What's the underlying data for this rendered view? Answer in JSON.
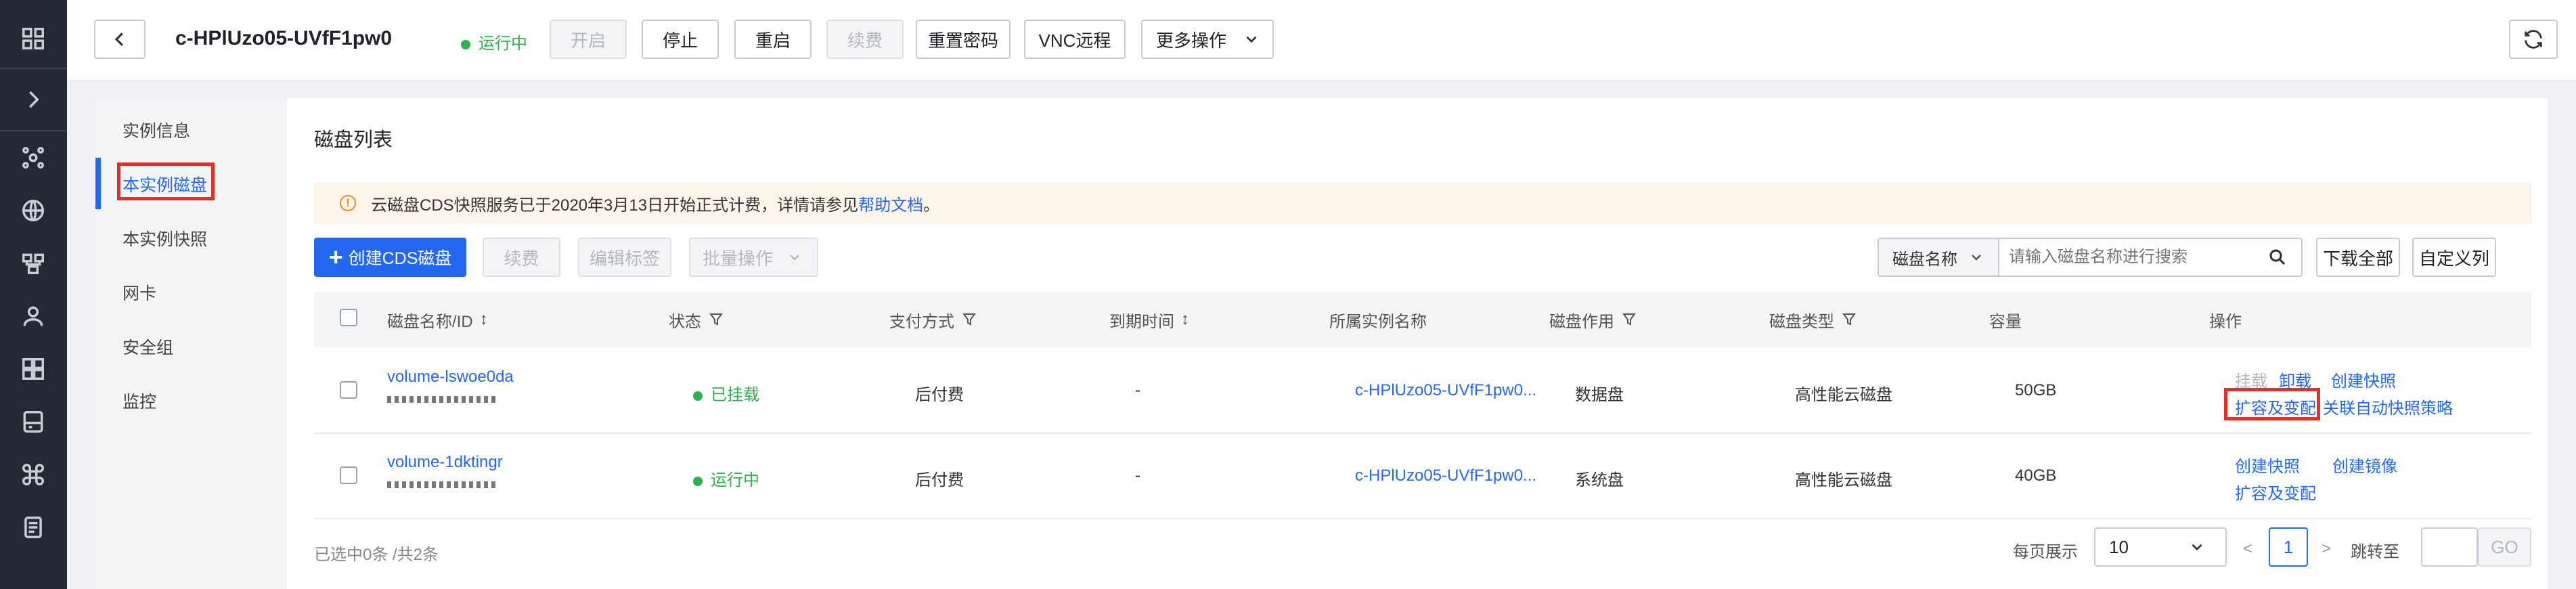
{
  "sidebar": {
    "icons": [
      "grid-icon",
      "chevron-right-icon",
      "network-icon",
      "globe-icon",
      "topology-icon",
      "user-group-icon",
      "apps-icon",
      "storage-icon",
      "command-icon",
      "document-icon"
    ]
  },
  "header": {
    "instance_name": "c-HPlUzo05-UVfF1pw0",
    "status": "运行中",
    "buttons": {
      "start": "开启",
      "stop": "停止",
      "restart": "重启",
      "renew": "续费",
      "reset_password": "重置密码",
      "vnc": "VNC远程",
      "more": "更多操作"
    }
  },
  "leftnav": {
    "items": [
      "实例信息",
      "本实例磁盘",
      "本实例快照",
      "网卡",
      "安全组",
      "监控"
    ],
    "active": "本实例磁盘"
  },
  "main": {
    "title": "磁盘列表",
    "notice_text": "云磁盘CDS快照服务已于2020年3月13日开始正式计费，详情请参见",
    "notice_link": "帮助文档",
    "notice_end": "。",
    "toolbar": {
      "create": "创建CDS磁盘",
      "renew": "续费",
      "edit_tags": "编辑标签",
      "batch": "批量操作",
      "search_type": "磁盘名称",
      "search_placeholder": "请输入磁盘名称进行搜索",
      "download_all": "下载全部",
      "custom_columns": "自定义列"
    },
    "columns": [
      "磁盘名称/ID",
      "状态",
      "支付方式",
      "到期时间",
      "所属实例名称",
      "磁盘作用",
      "磁盘类型",
      "容量",
      "操作"
    ],
    "rows": [
      {
        "name": "volume-lswoe0da",
        "status": "已挂载",
        "pay": "后付费",
        "expire": "-",
        "instance": "c-HPlUzo05-UVfF1pw0...",
        "role": "数据盘",
        "type": "高性能云磁盘",
        "capacity": "50GB",
        "ops": {
          "mount": "挂载",
          "unmount": "卸载",
          "snapshot": "创建快照",
          "resize": "扩容及变配",
          "auto_snapshot": "关联自动快照策略"
        }
      },
      {
        "name": "volume-1dktingr",
        "status": "运行中",
        "pay": "后付费",
        "expire": "-",
        "instance": "c-HPlUzo05-UVfF1pw0...",
        "role": "系统盘",
        "type": "高性能云磁盘",
        "capacity": "40GB",
        "ops": {
          "snapshot": "创建快照",
          "image": "创建镜像",
          "resize": "扩容及变配"
        }
      }
    ],
    "footer": {
      "selected": "已选中0条 /共2条",
      "page_size_label": "每页展示",
      "page_size": "10",
      "prev": "<",
      "page": "1",
      "next": ">",
      "jump_label": "跳转至",
      "go": "GO"
    }
  },
  "colors": {
    "accent": "#2468f2",
    "success": "#2bb24c",
    "highlight": "#e0302a",
    "sidebar_bg": "#232a33"
  }
}
